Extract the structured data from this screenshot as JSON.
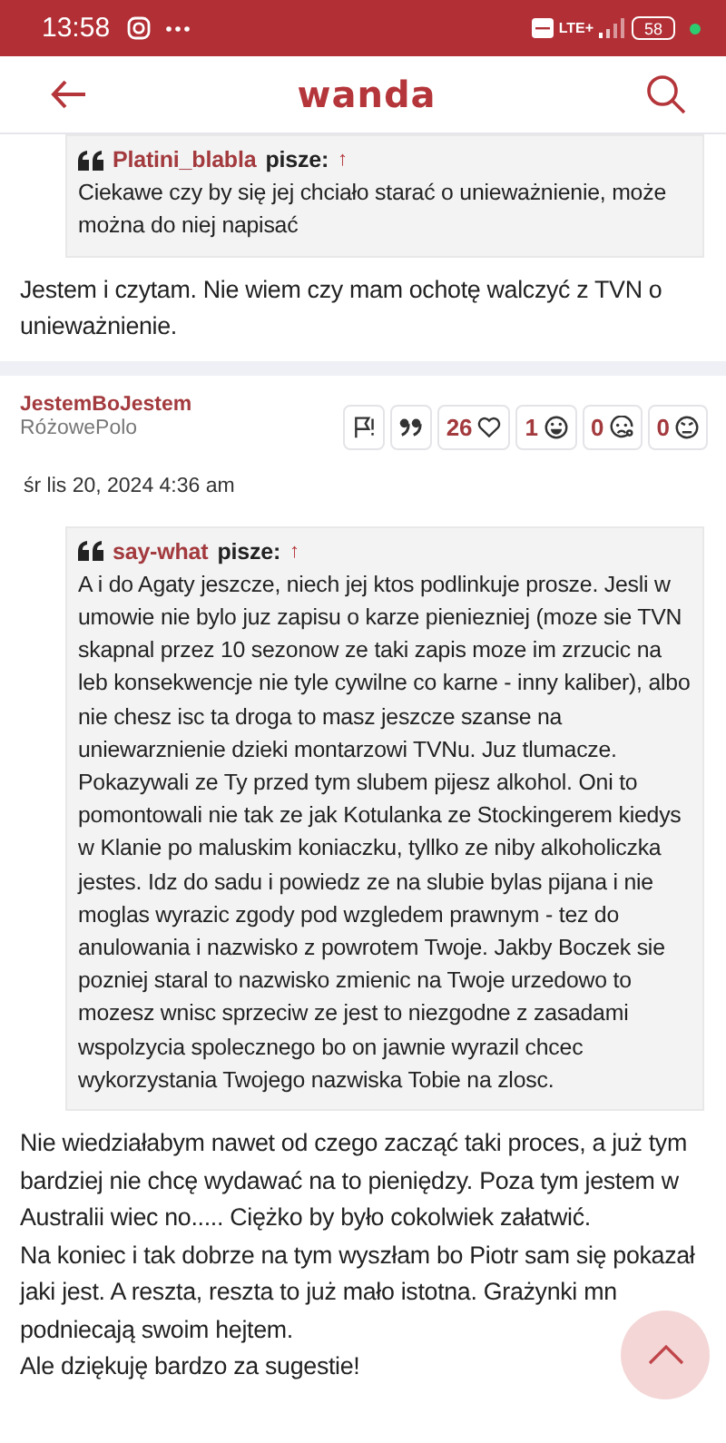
{
  "status_bar": {
    "time": "13:58",
    "network": "LTE+",
    "battery": "58"
  },
  "header": {
    "logo": "wanda"
  },
  "posts": [
    {
      "quote": {
        "author": "Platini_blabla",
        "says": "pisze:",
        "arrow": "↑",
        "text": "Ciekawe czy by się jej chciało starać o unieważnienie, może można do niej napisać"
      },
      "body": [
        "Jestem i czytam. Nie wiem czy mam ochotę walczyć z TVN o unieważnienie."
      ]
    },
    {
      "author": "JestemBoJestem",
      "rank": "RóżowePolo",
      "reactions": [
        {
          "kind": "report"
        },
        {
          "kind": "quote"
        },
        {
          "kind": "like",
          "count": "26"
        },
        {
          "kind": "laugh",
          "count": "1"
        },
        {
          "kind": "sad",
          "count": "0"
        },
        {
          "kind": "angry",
          "count": "0"
        }
      ],
      "date": "śr lis 20, 2024 4:36 am",
      "quote": {
        "author": "say-what",
        "says": "pisze:",
        "arrow": "↑",
        "text": "A i do Agaty jeszcze, niech jej ktos podlinkuje prosze. Jesli w umowie nie bylo juz zapisu o karze pieniezniej (moze sie TVN skapnal przez 10 sezonow ze taki zapis moze im zrzucic na leb konsekwencje nie tyle cywilne co karne - inny kaliber), albo nie chesz isc ta droga to masz jeszcze szanse na uniewarznienie dzieki montarzowi TVNu. Juz tlumacze. Pokazywali ze Ty przed tym slubem pijesz alkohol. Oni to pomontowali nie tak ze jak Kotulanka ze Stockingerem kiedys w Klanie po maluskim koniaczku, tyllko ze niby alkoholiczka jestes. Idz do sadu i powiedz ze na slubie bylas pijana i nie moglas wyrazic zgody pod wzgledem prawnym - tez do anulowania i nazwisko z powrotem Twoje. Jakby Boczek sie pozniej staral to nazwisko zmienic na Twoje urzedowo to mozesz wnisc sprzeciw ze jest to niezgodne z zasadami wspolzycia spolecznego bo on jawnie wyrazil chcec wykorzystania Twojego nazwiska Tobie na zlosc."
      },
      "body": [
        "Nie wiedziałabym nawet od czego zacząć taki proces, a już tym bardziej nie chcę wydawać na to pieniędzy. Poza tym jestem w Australii wiec no..... Ciężko by było cokolwiek załatwić.",
        "Na koniec i tak dobrze na tym wyszłam bo Piotr sam się pokazał",
        "jaki jest. A reszta, reszta to już mało istotna. Grażynki mn",
        "podniecają swoim hejtem.",
        "Ale dziękuję bardzo za sugestie!"
      ]
    }
  ]
}
